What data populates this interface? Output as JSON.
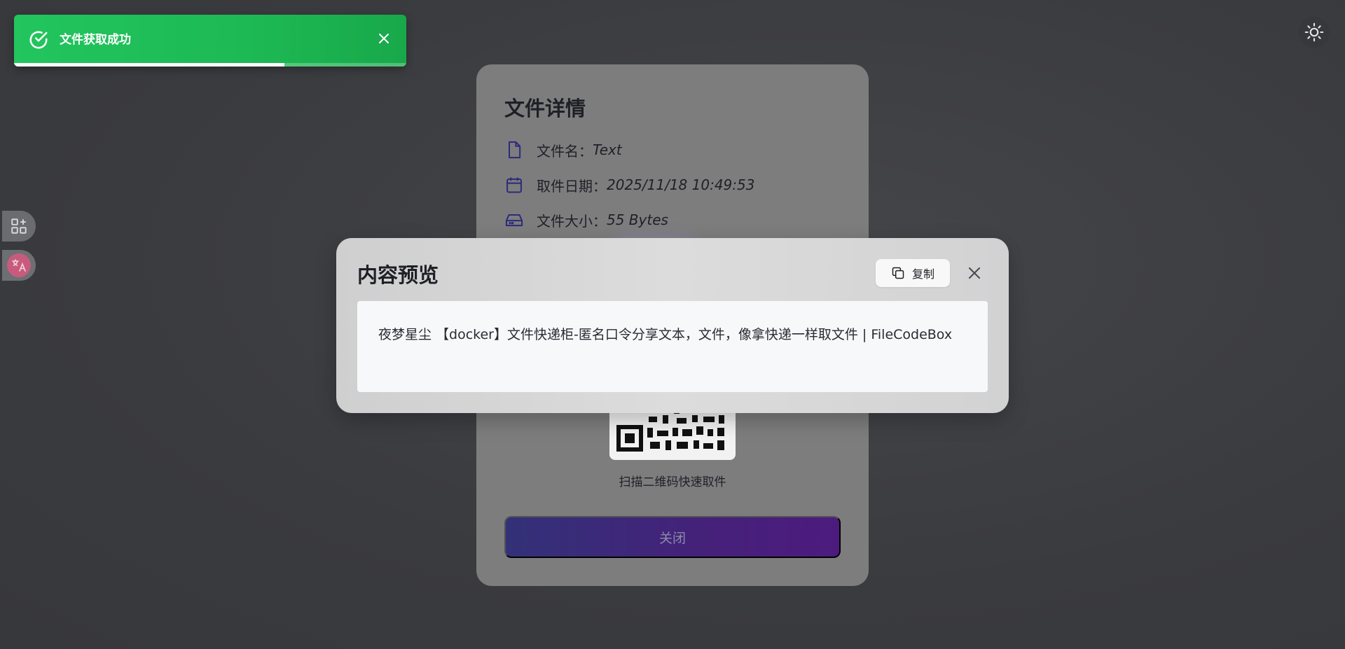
{
  "toast": {
    "message": "文件获取成功",
    "progress": 0.69,
    "color": "#22c55e"
  },
  "theme_toggle": {
    "icon": "sun-icon"
  },
  "left_tools": [
    {
      "icon": "apps-add-icon"
    },
    {
      "icon": "translate-icon"
    }
  ],
  "detail": {
    "title": "文件详情",
    "name_label": "文件名：",
    "name_value": "Text",
    "date_label": "取件日期：",
    "date_value": "2025/11/18 10:49:53",
    "size_label": "文件大小：",
    "size_value": "55 Bytes",
    "qr_caption": "扫描二维码快速取件",
    "close_label": "关闭"
  },
  "modal": {
    "title": "内容预览",
    "copy_label": "复制",
    "content": "夜梦星尘 【docker】文件快递柜-匿名口令分享文本，文件，像拿快递一样取文件 | FileCodeBox"
  }
}
